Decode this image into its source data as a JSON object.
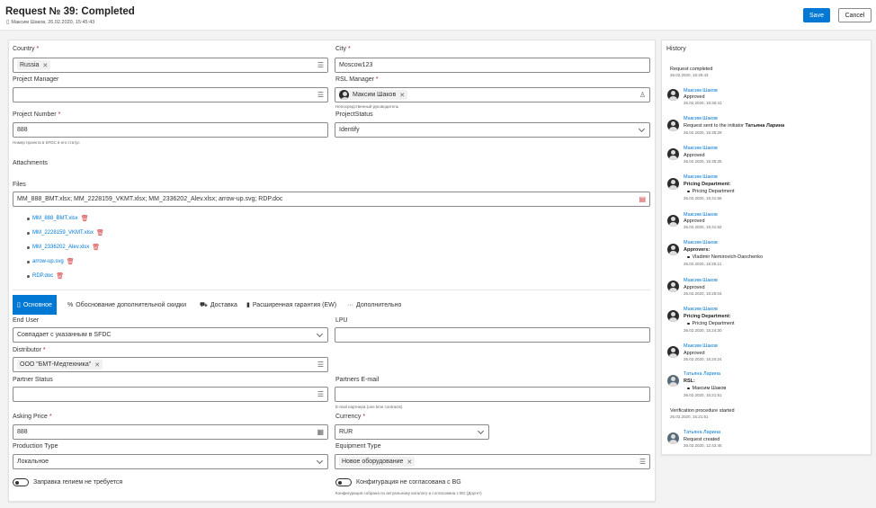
{
  "header": {
    "title": "Request № 39: Completed",
    "subtitle": "Максим Шаков, 26.02.2020, 15:45:43",
    "save_label": "Save",
    "cancel_label": "Cancel"
  },
  "form": {
    "country": {
      "label": "Country",
      "value": "Russia"
    },
    "city": {
      "label": "City",
      "value": "Moscow123"
    },
    "project_manager": {
      "label": "Project Manager",
      "value": ""
    },
    "rsl_manager": {
      "label": "RSL Manager",
      "value": "Максим Шаков",
      "hint": "Непосредственный руководитель"
    },
    "project_number": {
      "label": "Project Number",
      "value": "888",
      "hint": "Номер проекта в SFDC в его статус"
    },
    "project_status": {
      "label": "ProjectStatus",
      "value": "Identify"
    },
    "attachments_label": "Attachments",
    "files": {
      "label": "Files",
      "value": "MM_888_BMT.xlsx; MM_2228159_VKMT.xlsx; MM_2336202_Alev.xlsx; arrow-up.svg; RDP.doc",
      "list": [
        "MM_888_BMT.xlsx",
        "MM_2228159_VKMT.xlsx",
        "MM_2336202_Alev.xlsx",
        "arrow-up.svg",
        "RDP.doc"
      ]
    }
  },
  "tabs": [
    {
      "label": "Основное",
      "icon": "document-icon"
    },
    {
      "label": "Обоснование дополнительной скидки",
      "icon": "percent-icon"
    },
    {
      "label": "Доставка",
      "icon": "truck-icon"
    },
    {
      "label": "Расширенная гарантия (EW)",
      "icon": "shield-icon"
    },
    {
      "label": "Дополнительно",
      "icon": "more-icon"
    }
  ],
  "tab_form": {
    "end_user": {
      "label": "End User",
      "value": "Совпадает с указанным в SFDC"
    },
    "lpu": {
      "label": "LPU",
      "value": ""
    },
    "distributor": {
      "label": "Distributor",
      "value": "ООО \"БМТ-Медтехника\""
    },
    "partner_status": {
      "label": "Partner Status",
      "value": ""
    },
    "partners_email": {
      "label": "Partners E-mail",
      "value": "",
      "hint": "E-mail партнера (one time contracts)"
    },
    "asking_price": {
      "label": "Asking Price",
      "value": "888"
    },
    "currency": {
      "label": "Currency",
      "value": "RUR"
    },
    "production_type": {
      "label": "Production Type",
      "value": "Локальное"
    },
    "equipment_type": {
      "label": "Equipment Type",
      "value": "Новое оборудование"
    },
    "helium_toggle": {
      "label": "Заправка гелием не требуется"
    },
    "config_toggle": {
      "label": "Конфигурация не согласована с BG",
      "hint": "Конфигурация собрана по актуальному каталогу и согласована с BG (Доугет)"
    }
  },
  "history": {
    "title": "History",
    "items": [
      {
        "text": "Request completed",
        "date": "26.02.2020, 15:45:43"
      },
      {
        "name": "Максим Шаков",
        "text": "Approved",
        "date": "26.02.2020, 15:45:41"
      },
      {
        "name": "Максим Шаков",
        "text": "Request sent to the initiator",
        "bold": "Татьяна Ларина",
        "date": "26.02.2020, 15:45:29"
      },
      {
        "name": "Максим Шаков",
        "text": "Approved",
        "date": "26.02.2020, 15:45:25"
      },
      {
        "name": "Максим Шаков",
        "bold": "Pricing Department:",
        "bullets": [
          "Pricing Department"
        ],
        "date": "26.02.2020, 15:41:56"
      },
      {
        "name": "Максим Шаков",
        "text": "Approved",
        "date": "26.02.2020, 15:41:52"
      },
      {
        "name": "Максим Шаков",
        "bold": "Approvers:",
        "bullets": [
          "Vladimir Nemirovich-Danchenko"
        ],
        "date": "26.02.2020, 15:25:11"
      },
      {
        "name": "Максим Шаков",
        "text": "Approved",
        "date": "26.02.2020, 15:25:04"
      },
      {
        "name": "Максим Шаков",
        "bold": "Pricing Department:",
        "bullets": [
          "Pricing Department"
        ],
        "date": "26.02.2020, 15:24:30"
      },
      {
        "name": "Максим Шаков",
        "text": "Approved",
        "date": "26.02.2020, 15:24:24"
      },
      {
        "name": "Татьяна Ларина",
        "bold": "RSL:",
        "bullets": [
          "Максим Шаков"
        ],
        "date": "26.02.2020, 15:21:51"
      },
      {
        "text": "Verification procedure started",
        "date": "26.02.2020, 15:21:51"
      },
      {
        "name": "Татьяна Ларина",
        "text": "Request created",
        "date": "26.02.2020, 12:43:45"
      }
    ]
  }
}
